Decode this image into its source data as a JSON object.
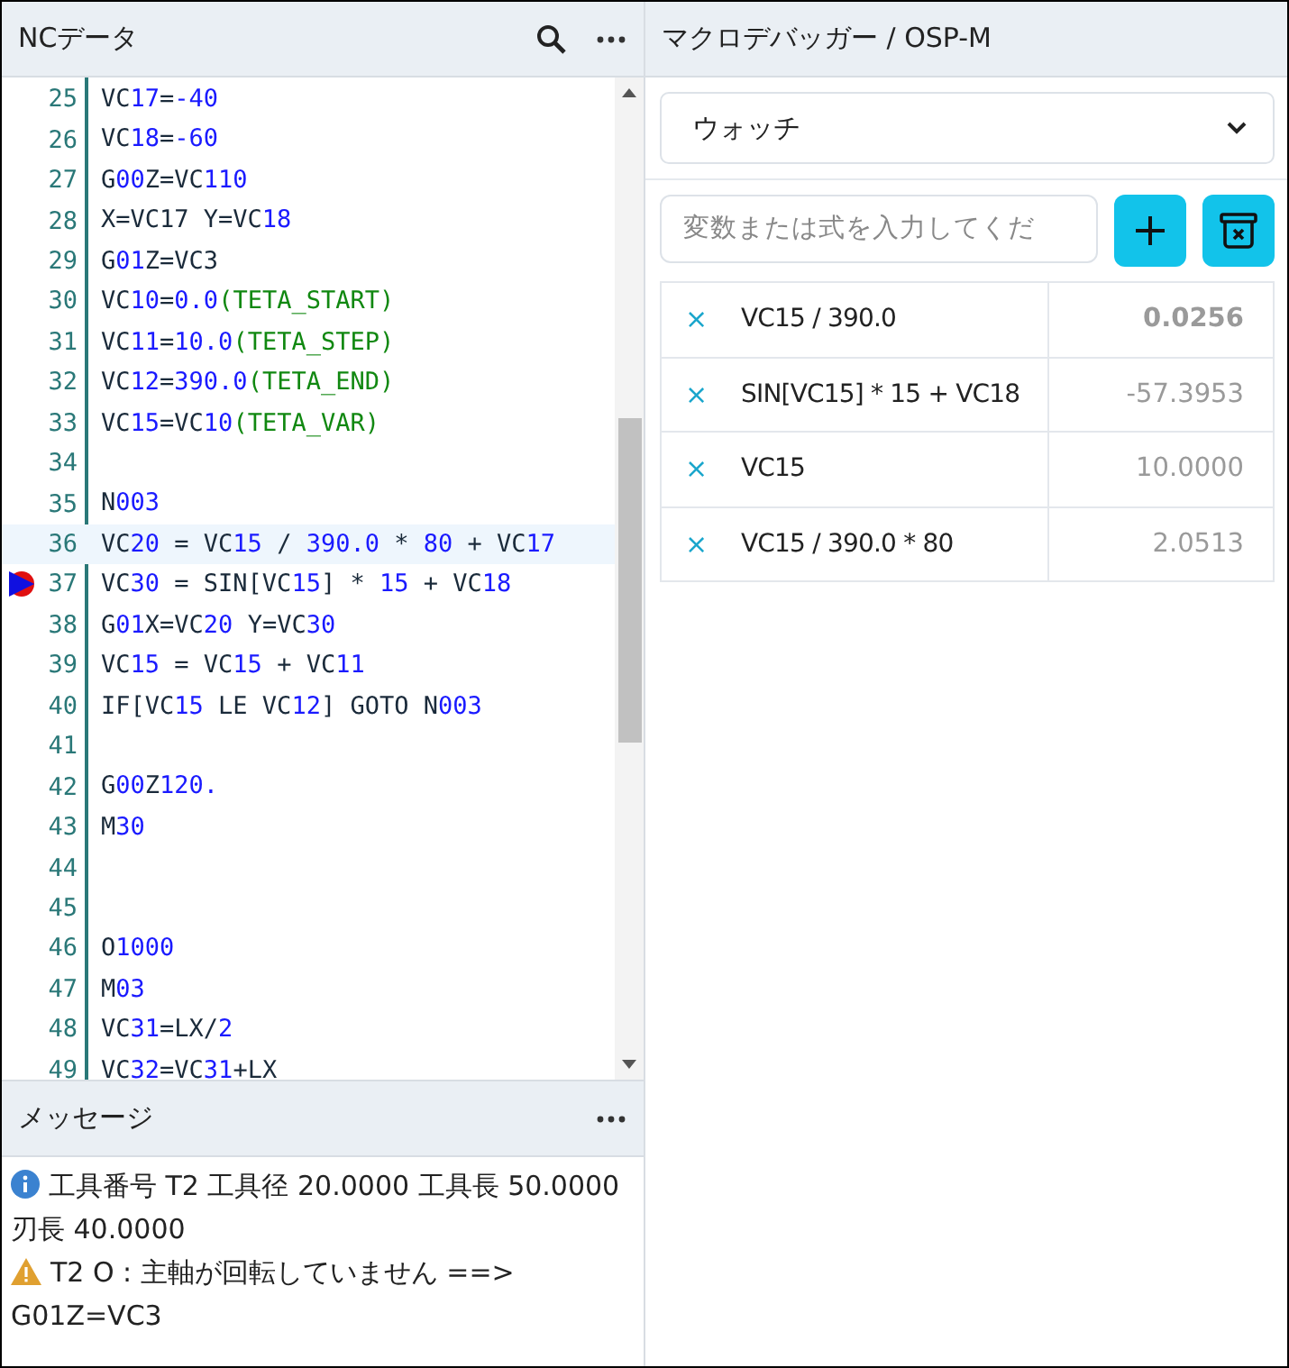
{
  "editor": {
    "title": "NCデータ",
    "lines": [
      {
        "number": "25",
        "current": false,
        "breakpoint": false,
        "segments": [
          {
            "t": "VC",
            "kind": "p"
          },
          {
            "t": "17",
            "kind": "n"
          },
          {
            "t": "=",
            "kind": "p"
          },
          {
            "t": "-40",
            "kind": "n"
          }
        ]
      },
      {
        "number": "26",
        "current": false,
        "breakpoint": false,
        "segments": [
          {
            "t": "VC",
            "kind": "p"
          },
          {
            "t": "18",
            "kind": "n"
          },
          {
            "t": "=",
            "kind": "p"
          },
          {
            "t": "-60",
            "kind": "n"
          }
        ]
      },
      {
        "number": "27",
        "current": false,
        "breakpoint": false,
        "segments": [
          {
            "t": "G",
            "kind": "p"
          },
          {
            "t": "00",
            "kind": "n"
          },
          {
            "t": "Z=VC",
            "kind": "p"
          },
          {
            "t": "110",
            "kind": "n"
          }
        ]
      },
      {
        "number": "28",
        "current": false,
        "breakpoint": false,
        "segments": [
          {
            "t": "X=VC17 Y=VC",
            "kind": "p"
          },
          {
            "t": "18",
            "kind": "n"
          }
        ]
      },
      {
        "number": "29",
        "current": false,
        "breakpoint": false,
        "segments": [
          {
            "t": "G",
            "kind": "p"
          },
          {
            "t": "01",
            "kind": "n"
          },
          {
            "t": "Z=VC3",
            "kind": "p"
          }
        ]
      },
      {
        "number": "30",
        "current": false,
        "breakpoint": false,
        "segments": [
          {
            "t": "VC",
            "kind": "p"
          },
          {
            "t": "10",
            "kind": "n"
          },
          {
            "t": "=",
            "kind": "p"
          },
          {
            "t": "0.0",
            "kind": "n"
          },
          {
            "t": "(TETA_START)",
            "kind": "c"
          }
        ]
      },
      {
        "number": "31",
        "current": false,
        "breakpoint": false,
        "segments": [
          {
            "t": "VC",
            "kind": "p"
          },
          {
            "t": "11",
            "kind": "n"
          },
          {
            "t": "=",
            "kind": "p"
          },
          {
            "t": "10.0",
            "kind": "n"
          },
          {
            "t": "(TETA_STEP)",
            "kind": "c"
          }
        ]
      },
      {
        "number": "32",
        "current": false,
        "breakpoint": false,
        "segments": [
          {
            "t": "VC",
            "kind": "p"
          },
          {
            "t": "12",
            "kind": "n"
          },
          {
            "t": "=",
            "kind": "p"
          },
          {
            "t": "390.0",
            "kind": "n"
          },
          {
            "t": "(TETA_END)",
            "kind": "c"
          }
        ]
      },
      {
        "number": "33",
        "current": false,
        "breakpoint": false,
        "segments": [
          {
            "t": "VC",
            "kind": "p"
          },
          {
            "t": "15",
            "kind": "n"
          },
          {
            "t": "=VC",
            "kind": "p"
          },
          {
            "t": "10",
            "kind": "n"
          },
          {
            "t": "(TETA_VAR)",
            "kind": "c"
          }
        ]
      },
      {
        "number": "34",
        "current": false,
        "breakpoint": false
      },
      {
        "number": "35",
        "current": false,
        "breakpoint": false,
        "segments": [
          {
            "t": "N",
            "kind": "p"
          },
          {
            "t": "003",
            "kind": "n"
          }
        ]
      },
      {
        "number": "36",
        "current": true,
        "breakpoint": false,
        "segments": [
          {
            "t": "VC",
            "kind": "p"
          },
          {
            "t": "20",
            "kind": "n"
          },
          {
            "t": " = VC",
            "kind": "p"
          },
          {
            "t": "15",
            "kind": "n"
          },
          {
            "t": " / ",
            "kind": "p"
          },
          {
            "t": "390.0",
            "kind": "n"
          },
          {
            "t": " * ",
            "kind": "p"
          },
          {
            "t": "80",
            "kind": "n"
          },
          {
            "t": " + VC",
            "kind": "p"
          },
          {
            "t": "17",
            "kind": "n"
          }
        ]
      },
      {
        "number": "37",
        "current": false,
        "breakpoint": true,
        "segments": [
          {
            "t": "VC",
            "kind": "p"
          },
          {
            "t": "30",
            "kind": "n"
          },
          {
            "t": " = SIN[VC",
            "kind": "p"
          },
          {
            "t": "15",
            "kind": "n"
          },
          {
            "t": "] * ",
            "kind": "p"
          },
          {
            "t": "15",
            "kind": "n"
          },
          {
            "t": " + VC",
            "kind": "p"
          },
          {
            "t": "18",
            "kind": "n"
          }
        ]
      },
      {
        "number": "38",
        "current": false,
        "breakpoint": false,
        "segments": [
          {
            "t": "G",
            "kind": "p"
          },
          {
            "t": "01",
            "kind": "n"
          },
          {
            "t": "X=VC",
            "kind": "p"
          },
          {
            "t": "20",
            "kind": "n"
          },
          {
            "t": " Y=VC",
            "kind": "p"
          },
          {
            "t": "30",
            "kind": "n"
          }
        ]
      },
      {
        "number": "39",
        "current": false,
        "breakpoint": false,
        "segments": [
          {
            "t": "VC",
            "kind": "p"
          },
          {
            "t": "15",
            "kind": "n"
          },
          {
            "t": " = VC",
            "kind": "p"
          },
          {
            "t": "15",
            "kind": "n"
          },
          {
            "t": " + VC",
            "kind": "p"
          },
          {
            "t": "11",
            "kind": "n"
          }
        ]
      },
      {
        "number": "40",
        "current": false,
        "breakpoint": false,
        "segments": [
          {
            "t": "IF[VC",
            "kind": "p"
          },
          {
            "t": "15",
            "kind": "n"
          },
          {
            "t": " LE VC",
            "kind": "p"
          },
          {
            "t": "12",
            "kind": "n"
          },
          {
            "t": "] GOTO N",
            "kind": "p"
          },
          {
            "t": "003",
            "kind": "n"
          }
        ]
      },
      {
        "number": "41",
        "current": false,
        "breakpoint": false
      },
      {
        "number": "42",
        "current": false,
        "breakpoint": false,
        "segments": [
          {
            "t": "G",
            "kind": "p"
          },
          {
            "t": "00",
            "kind": "n"
          },
          {
            "t": "Z",
            "kind": "p"
          },
          {
            "t": "120.",
            "kind": "n"
          }
        ]
      },
      {
        "number": "43",
        "current": false,
        "breakpoint": false,
        "segments": [
          {
            "t": "M",
            "kind": "p"
          },
          {
            "t": "30",
            "kind": "n"
          }
        ]
      },
      {
        "number": "44",
        "current": false,
        "breakpoint": false
      },
      {
        "number": "45",
        "current": false,
        "breakpoint": false
      },
      {
        "number": "46",
        "current": false,
        "breakpoint": false,
        "segments": [
          {
            "t": "O",
            "kind": "p"
          },
          {
            "t": "1000",
            "kind": "n"
          }
        ]
      },
      {
        "number": "47",
        "current": false,
        "breakpoint": false,
        "segments": [
          {
            "t": "M",
            "kind": "p"
          },
          {
            "t": "03",
            "kind": "n"
          }
        ]
      },
      {
        "number": "48",
        "current": false,
        "breakpoint": false,
        "segments": [
          {
            "t": "VC",
            "kind": "p"
          },
          {
            "t": "31",
            "kind": "n"
          },
          {
            "t": "=LX/",
            "kind": "p"
          },
          {
            "t": "2",
            "kind": "n"
          }
        ]
      },
      {
        "number": "49",
        "current": false,
        "breakpoint": false,
        "segments": [
          {
            "t": "VC",
            "kind": "p"
          },
          {
            "t": "32",
            "kind": "n"
          },
          {
            "t": "=VC",
            "kind": "p"
          },
          {
            "t": "31",
            "kind": "n"
          },
          {
            "t": "+LX",
            "kind": "p"
          }
        ]
      }
    ]
  },
  "messages": {
    "title": "メッセージ",
    "items": [
      {
        "kind": "info",
        "text": "工具番号 T2 工具径 20.0000 工具長 50.0000 刃長 40.0000"
      },
      {
        "kind": "warning",
        "text": "T2 O : 主軸が回転していません ==> G01Z=VC3"
      }
    ]
  },
  "debugger": {
    "title": "マクロデバッガー / OSP-M",
    "mode": "ウォッチ",
    "placeholder": "変数または式を入力してくだ",
    "watches": [
      {
        "remove": "×",
        "expression": "VC15 / 390.0",
        "value": "0.0256",
        "changed": true
      },
      {
        "remove": "×",
        "expression": "SIN[VC15] * 15 + VC18",
        "value": "-57.3953",
        "changed": false
      },
      {
        "remove": "×",
        "expression": "VC15",
        "value": "10.0000",
        "changed": false
      },
      {
        "remove": "×",
        "expression": "VC15 / 390.0 * 80",
        "value": "2.0513",
        "changed": false
      }
    ]
  }
}
